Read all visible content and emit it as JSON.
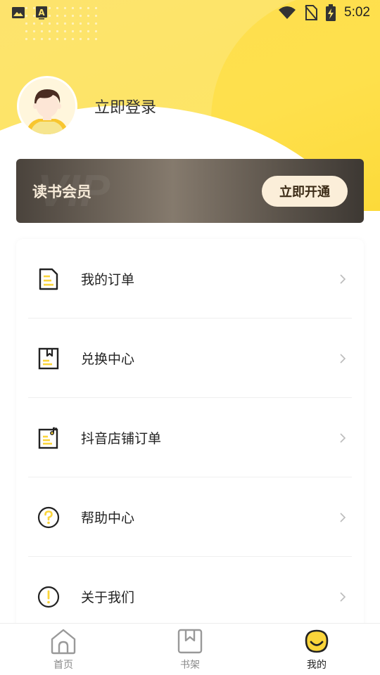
{
  "status_bar": {
    "time": "5:02",
    "left_icons": [
      "image-icon",
      "font-a-icon"
    ],
    "right_icons": [
      "wifi-icon",
      "no-sim-icon",
      "battery-charging-icon"
    ]
  },
  "profile": {
    "avatar_icon": "user-avatar",
    "login_text": "立即登录"
  },
  "vip": {
    "title": "读书会员",
    "watermark": "VIP",
    "button_label": "立即开通"
  },
  "menu": {
    "items": [
      {
        "label": "我的订单",
        "icon": "order-doc-icon"
      },
      {
        "label": "兑换中心",
        "icon": "redeem-book-icon"
      },
      {
        "label": "抖音店铺订单",
        "icon": "douyin-order-icon"
      },
      {
        "label": "帮助中心",
        "icon": "help-question-icon"
      },
      {
        "label": "关于我们",
        "icon": "about-exclamation-icon"
      }
    ]
  },
  "nav": {
    "items": [
      {
        "label": "首页",
        "icon": "home-icon",
        "active": false
      },
      {
        "label": "书架",
        "icon": "bookshelf-icon",
        "active": false
      },
      {
        "label": "我的",
        "icon": "profile-smile-icon",
        "active": true
      }
    ]
  },
  "colors": {
    "accent_yellow": "#fde36d",
    "icon_yellow": "#fbd53a",
    "vip_dark": "#4a433c",
    "vip_button": "#fbeed9"
  }
}
